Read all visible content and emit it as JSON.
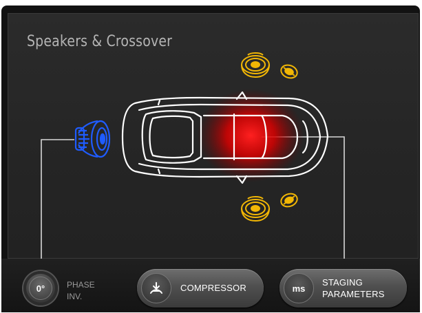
{
  "screen": {
    "title": "Speakers & Crossover"
  },
  "speakers": {
    "front_left": "speaker-icon",
    "front_right": "speaker-icon",
    "subwoofer": "subwoofer-icon",
    "selected": "subwoofer"
  },
  "colors": {
    "speaker_gold": "#f2b705",
    "subwoofer_blue": "#1f5cff",
    "listening_glow": "#ff0000",
    "car_outline": "#ffffff",
    "title_text": "#b4b4b4"
  },
  "controls": {
    "phase": {
      "value": "0°",
      "label_line1": "PHASE",
      "label_line2": "INV."
    },
    "compressor": {
      "icon": "compressor-icon",
      "label": "COMPRESSOR"
    },
    "staging": {
      "icon_text": "ms",
      "label_line1": "STAGING",
      "label_line2": "PARAMETERS"
    }
  }
}
